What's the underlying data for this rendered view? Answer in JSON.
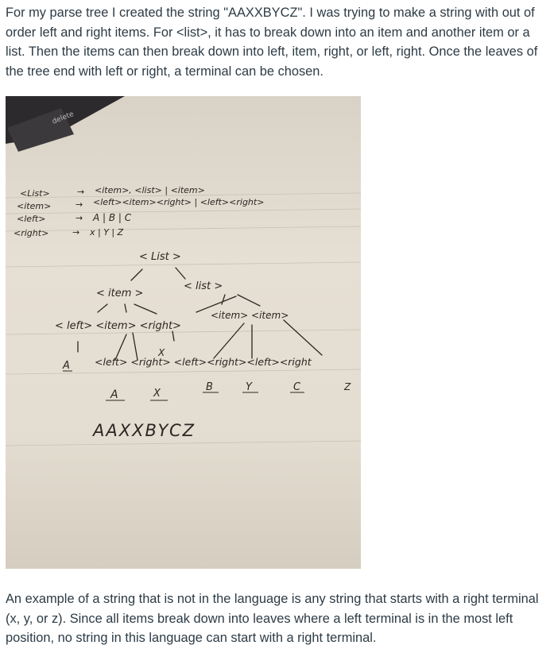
{
  "post": {
    "intro_text": "For my parse tree I created the string \"AAXXBYCZ\". I was trying to make a string with out of order left and right items. For <list>, it has to break down into an item and another item or a list. Then the items can then break down into left, item, right, or left, right. Once the leaves of the tree end with left or right, a terminal can be chosen.",
    "conclusion_text": "An example of a string that is not in the language is any string that starts with a right terminal (x, y, or z). Since all items break down into leaves where a left terminal is in the most left position, no string in this language can start with a right terminal."
  },
  "photo": {
    "keyboard_key": "delete",
    "grammar": {
      "rule1_lhs": "<List>",
      "rule1_rhs": "<item>, <list> | <item>",
      "rule2_lhs": "<item>",
      "rule2_rhs": "<left><item><right> | <left><right>",
      "rule3_lhs": "<left>",
      "rule3_rhs": "A | B | C",
      "rule4_lhs": "<right>",
      "rule4_rhs": "x | Y | Z"
    },
    "tree": {
      "root": "< List >",
      "item": "< item >",
      "list": "< list >",
      "level3_left": "< left> <item> <right>",
      "level3_right": "<item> <item>",
      "level4": "<left> <right> <left><right><left><right",
      "leaf_A1": "A",
      "leaf_A2": "A",
      "leaf_X1": "X",
      "leaf_X2": "X",
      "leaf_B": "B",
      "leaf_Y": "Y",
      "leaf_C": "C",
      "leaf_Z": "Z",
      "result": "AAXXBYCZ"
    }
  }
}
